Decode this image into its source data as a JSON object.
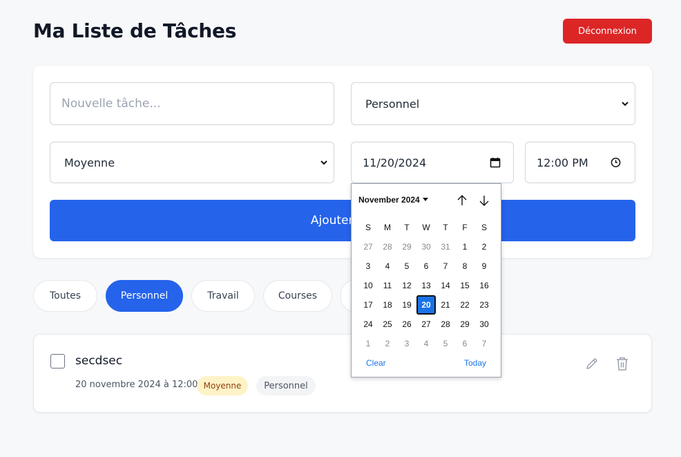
{
  "header": {
    "title": "Ma Liste de Tâches",
    "logout_label": "Déconnexion"
  },
  "form": {
    "task_placeholder": "Nouvelle tâche...",
    "category_value": "Personnel",
    "priority_value": "Moyenne",
    "date_value": "11/20/2024",
    "time_value": "12:00 PM",
    "add_button_label": "Ajouter la"
  },
  "filters": [
    "Toutes",
    "Personnel",
    "Travail",
    "Courses"
  ],
  "active_filter": "Personnel",
  "task": {
    "title": "secdsec",
    "datetime": "20 novembre 2024 à 12:00",
    "priority": "Moyenne",
    "category": "Personnel"
  },
  "datepicker": {
    "month_label": "November 2024",
    "weekdays": [
      "S",
      "M",
      "T",
      "W",
      "T",
      "F",
      "S"
    ],
    "days": [
      [
        "27",
        "28",
        "29",
        "30",
        "31",
        "1",
        "2"
      ],
      [
        "3",
        "4",
        "5",
        "6",
        "7",
        "8",
        "9"
      ],
      [
        "10",
        "11",
        "12",
        "13",
        "14",
        "15",
        "16"
      ],
      [
        "17",
        "18",
        "19",
        "20",
        "21",
        "22",
        "23"
      ],
      [
        "24",
        "25",
        "26",
        "27",
        "28",
        "29",
        "30"
      ],
      [
        "1",
        "2",
        "3",
        "4",
        "5",
        "6",
        "7"
      ]
    ],
    "selected_day": "20",
    "clear_label": "Clear",
    "today_label": "Today"
  },
  "colors": {
    "primary": "#2563eb",
    "danger": "#dc2626",
    "picker_accent": "#1a73e8"
  }
}
